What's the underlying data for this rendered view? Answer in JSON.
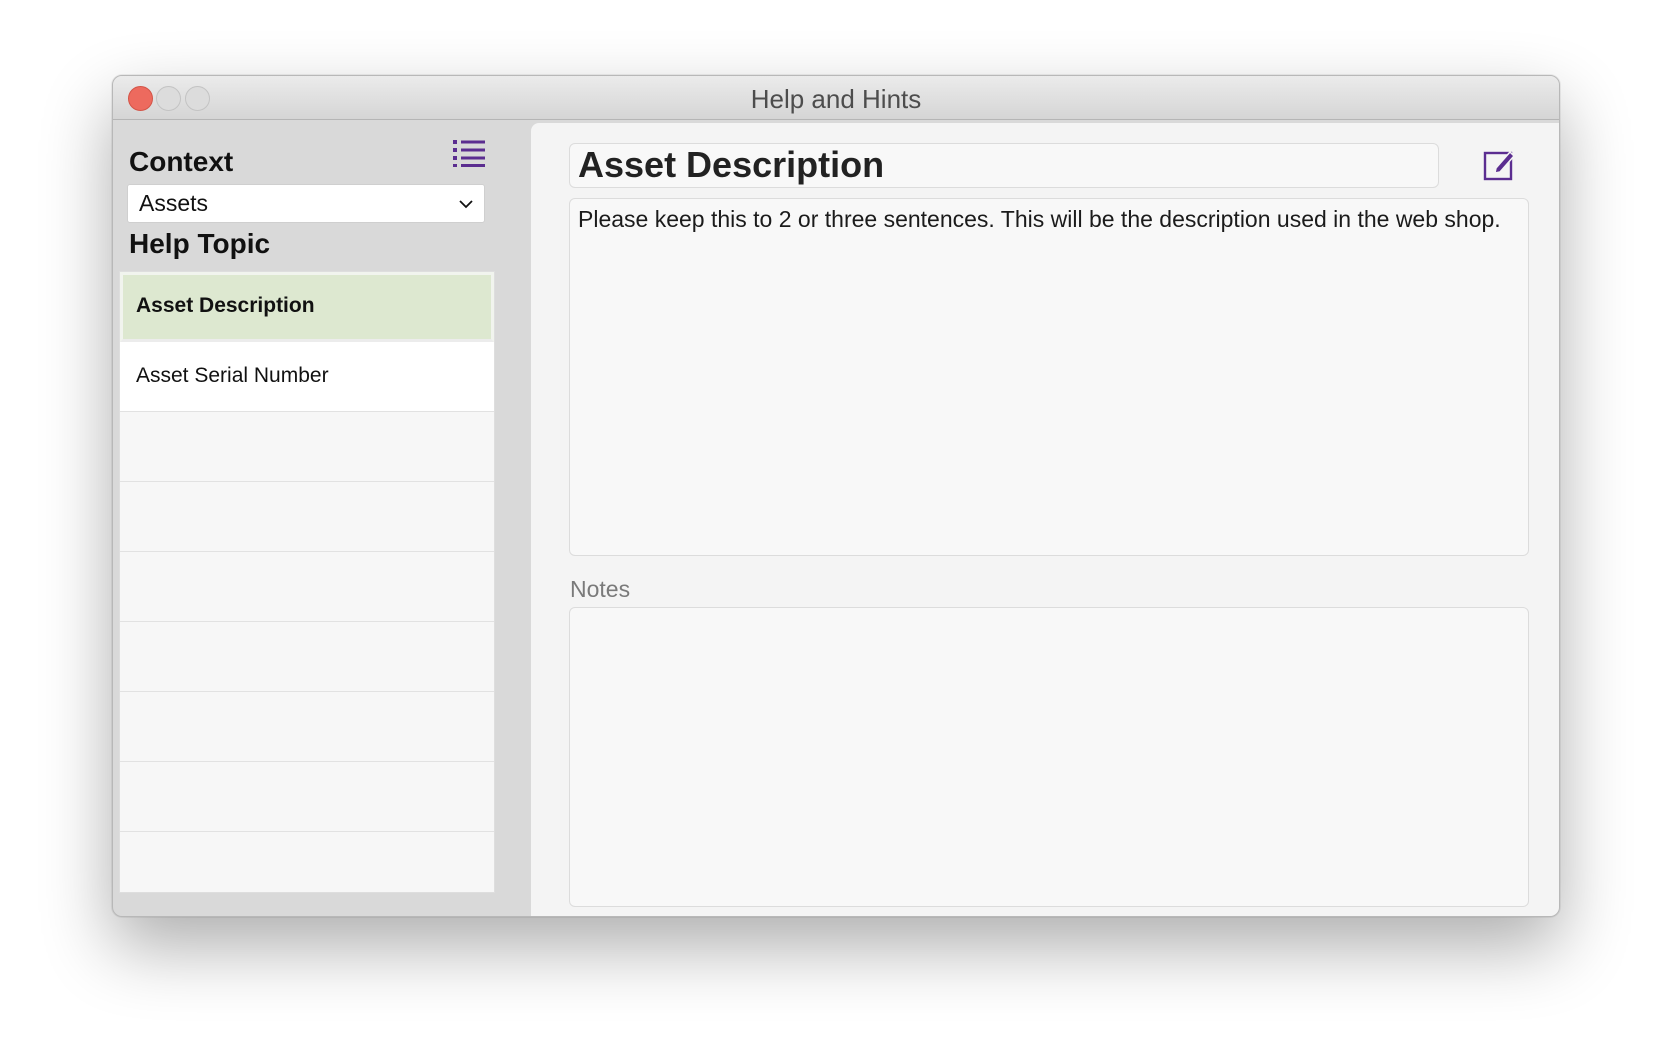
{
  "window": {
    "title": "Help and Hints"
  },
  "sidebar": {
    "context_label": "Context",
    "context_value": "Assets",
    "help_topic_label": "Help Topic",
    "topics": [
      {
        "label": "Asset Description",
        "selected": true
      },
      {
        "label": "Asset Serial Number",
        "selected": false
      },
      {
        "label": ""
      },
      {
        "label": ""
      },
      {
        "label": ""
      },
      {
        "label": ""
      },
      {
        "label": ""
      },
      {
        "label": ""
      },
      {
        "label": ""
      }
    ]
  },
  "main": {
    "topic_title": "Asset Description",
    "description": "Please keep this to 2 or three sentences. This will be the description used in the web shop.",
    "notes_label": "Notes",
    "notes_value": ""
  },
  "icons": {
    "list": "list-icon",
    "edit": "edit-icon",
    "dropdown": "chevron-down-icon"
  },
  "colors": {
    "accent": "#5b2d90",
    "selected_row": "#dde8d0",
    "close_button": "#ed6a5e"
  }
}
